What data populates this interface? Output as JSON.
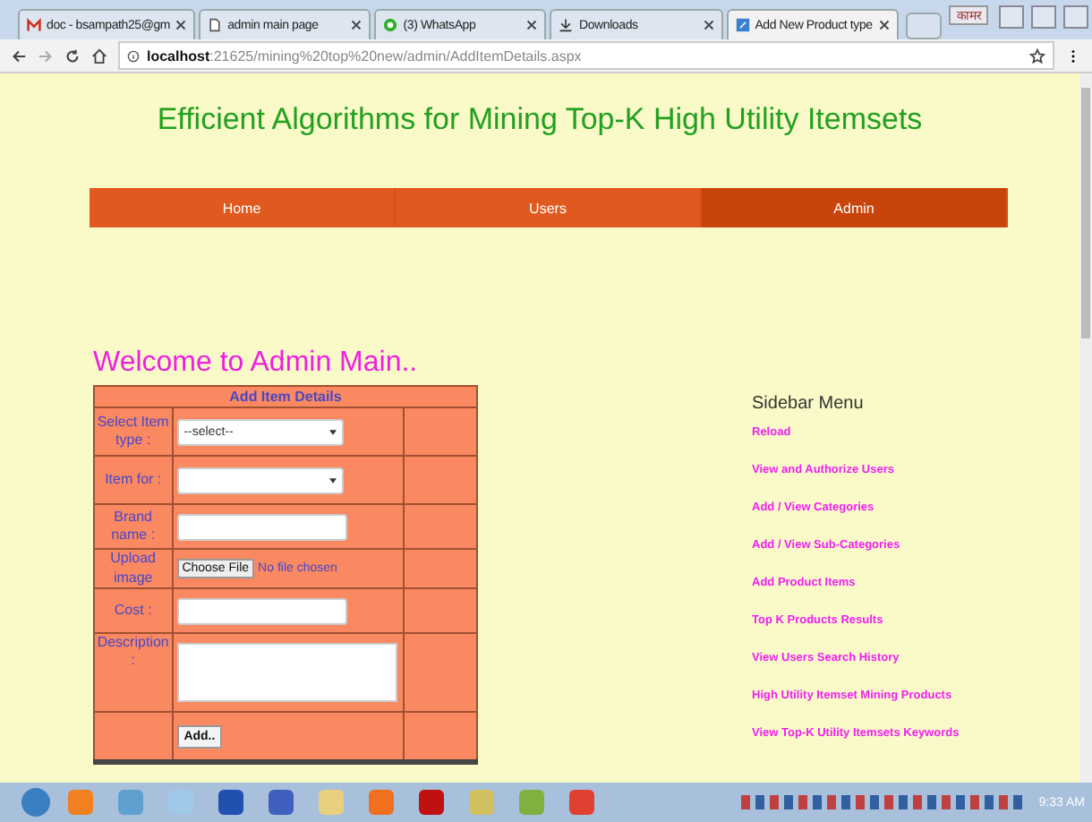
{
  "browser": {
    "tabs": [
      {
        "title": "doc - bsampath25@gm",
        "selected": false
      },
      {
        "title": "admin main page",
        "selected": false
      },
      {
        "title": "(3) WhatsApp",
        "selected": false
      },
      {
        "title": "Downloads",
        "selected": false
      },
      {
        "title": "Add New Product type",
        "selected": true
      }
    ],
    "profile": "कामर",
    "url_host": "localhost",
    "url_rest": ":21625/mining%20top%20new/admin/AddItemDetails.aspx"
  },
  "page": {
    "title": "Efficient Algorithms for Mining Top-K High Utility Itemsets",
    "nav": [
      {
        "label": "Home",
        "selected": false
      },
      {
        "label": "Users",
        "selected": false
      },
      {
        "label": "Admin",
        "selected": true
      }
    ],
    "welcome": "Welcome to Admin Main..",
    "form": {
      "title": "Add Item Details",
      "fields": [
        {
          "kind": "select",
          "label": "Select Item type :",
          "value": "--select--"
        },
        {
          "kind": "select",
          "label": "Item for :"
        },
        {
          "kind": "text",
          "label": "Brand name :"
        },
        {
          "kind": "file",
          "label": "Upload image",
          "button": "Choose File",
          "status": "No file chosen"
        },
        {
          "kind": "text",
          "label": "Cost :"
        },
        {
          "kind": "textarea",
          "label": "Description :"
        }
      ],
      "submit": "Add.."
    },
    "sidebar": {
      "heading": "Sidebar Menu",
      "links": [
        "Reload",
        "View and Authorize Users",
        "Add / View Categories",
        "Add / View Sub-Categories",
        "Add Product Items",
        "Top K Products Results",
        "View Users Search History",
        "High Utility Itemset Mining Products",
        "View Top-K Utility Itemsets Keywords"
      ]
    }
  },
  "taskbar": {
    "time": "9:33 AM"
  }
}
